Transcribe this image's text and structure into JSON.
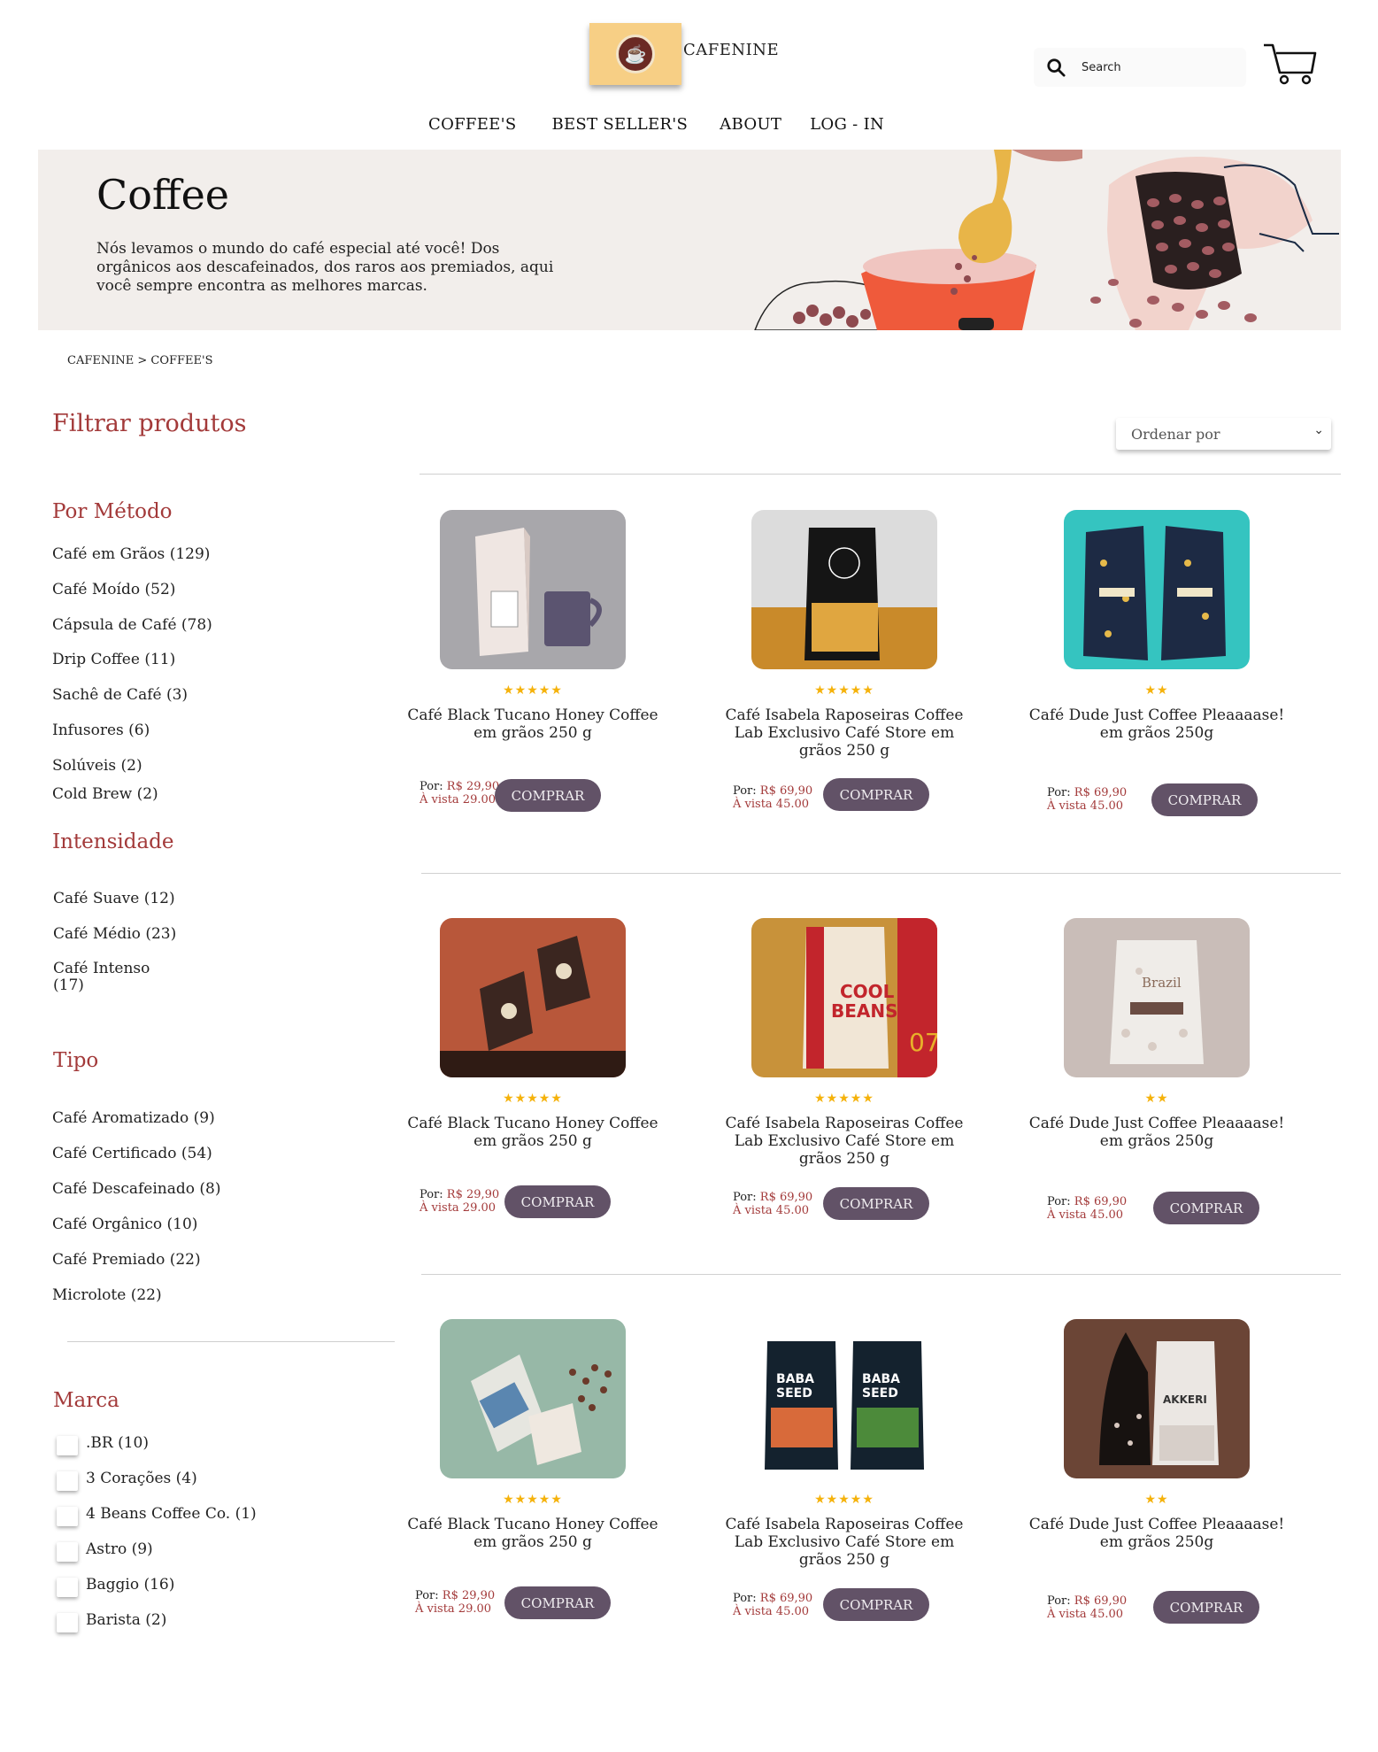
{
  "header": {
    "brand": "CAFENINE",
    "search_placeholder": "Search",
    "nav": [
      "COFFEE'S",
      "BEST SELLER'S",
      "ABOUT",
      "LOG - IN"
    ]
  },
  "hero": {
    "title": "Coffee",
    "text": "Nós levamos o mundo do café especial até você! Dos orgânicos aos descafeinados, dos raros aos premiados, aqui você sempre encontra as melhores marcas."
  },
  "breadcrumb": "CAFENINE > COFFEE'S",
  "sidebar": {
    "title": "Filtrar produtos",
    "metodo_title": "Por Método",
    "metodo": [
      "Café em Grãos (129)",
      "Café Moído (52)",
      "Cápsula de Café (78)",
      "Drip Coffee (11)",
      "Sachê de Café (3)",
      "Infusores (6)",
      "Solúveis (2)",
      "Cold Brew (2)"
    ],
    "intensidade_title": "Intensidade",
    "intensidade": [
      "Café Suave (12)",
      "Café Médio (23)",
      "Café Intenso\n(17)"
    ],
    "tipo_title": "Tipo",
    "tipo": [
      "Café Aromatizado (9)",
      "Café Certificado (54)",
      "Café Descafeinado (8)",
      "Café Orgânico (10)",
      "Café Premiado (22)",
      "Microlote (22)"
    ],
    "marca_title": "Marca",
    "marca": [
      ".BR (10)",
      "3 Corações (4)",
      "4 Beans Coffee Co. (1)",
      "Astro (9)",
      "Baggio (16)",
      "Barista (2)"
    ]
  },
  "sort": {
    "label": "Ordenar por"
  },
  "buy_label": "COMPRAR",
  "colors": {
    "accent_red": "#a33a3a",
    "button": "#625267",
    "star": "#f5b20b",
    "logo_bg": "#f7cf85"
  },
  "products": [
    {
      "name": "Café Black Tucano Honey Coffee em grãos 250 g",
      "rating": 5,
      "price_label": "Por:",
      "price": "R$ 29,90",
      "cash": "À vista 29.00"
    },
    {
      "name": "Café Isabela Raposeiras Coffee Lab Exclusivo Café Store em grãos 250 g",
      "rating": 5,
      "price_label": "Por:",
      "price": "R$ 69,90",
      "cash": "À vista 45.00"
    },
    {
      "name": "Café Dude Just Coffee Pleaaaase! em grãos 250g",
      "rating": 2,
      "price_label": "Por:",
      "price": "R$ 69,90",
      "cash": "À vista 45.00"
    },
    {
      "name": "Café Black Tucano Honey Coffee em grãos 250 g",
      "rating": 5,
      "price_label": "Por:",
      "price": "R$ 29,90",
      "cash": "À vista 29.00"
    },
    {
      "name": "Café Isabela Raposeiras Coffee Lab Exclusivo Café Store em grãos 250 g",
      "rating": 5,
      "price_label": "Por:",
      "price": "R$ 69,90",
      "cash": "À vista 45.00"
    },
    {
      "name": "Café Dude Just Coffee Pleaaaase! em grãos 250g",
      "rating": 2,
      "price_label": "Por:",
      "price": "R$ 69,90",
      "cash": "À vista 45.00"
    },
    {
      "name": "Café Black Tucano Honey Coffee em grãos 250 g",
      "rating": 5,
      "price_label": "Por:",
      "price": "R$ 29,90",
      "cash": "À vista 29.00"
    },
    {
      "name": "Café Isabela Raposeiras Coffee Lab Exclusivo Café Store em grãos 250 g",
      "rating": 5,
      "price_label": "Por:",
      "price": "R$ 69,90",
      "cash": "À vista 45.00"
    },
    {
      "name": "Café Dude Just Coffee Pleaaaase! em grãos 250g",
      "rating": 2,
      "price_label": "Por:",
      "price": "R$ 69,90",
      "cash": "À vista 45.00"
    }
  ]
}
